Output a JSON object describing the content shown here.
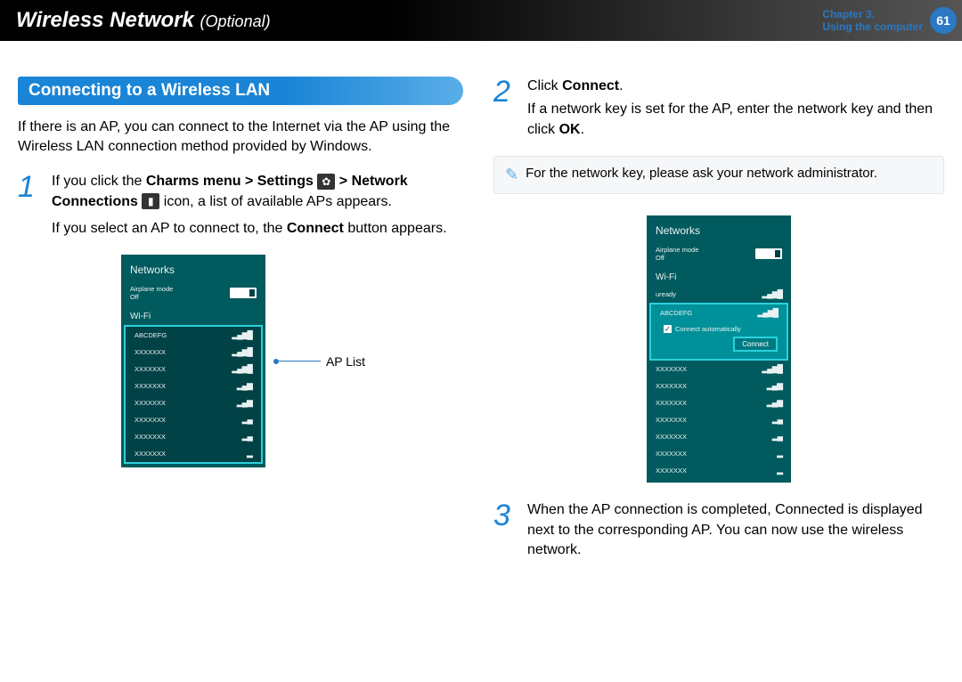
{
  "header": {
    "title": "Wireless Network",
    "subtitle": "(Optional)",
    "chapter_line1": "Chapter 3.",
    "chapter_line2": "Using the computer",
    "page": "61"
  },
  "section_heading": "Connecting to a Wireless LAN",
  "intro": "If there is an AP, you can connect to the Internet via the AP using the Wireless LAN connection method provided by Windows.",
  "steps": {
    "one": {
      "num": "1",
      "a": "If you click the ",
      "b": "Charms menu > Settings",
      "c": " > Network Connections",
      "d": " icon, a list of available APs appears.",
      "e": "If you select an AP to connect to, the ",
      "f": "Connect",
      "g": " button appears."
    },
    "two": {
      "num": "2",
      "a": "Click ",
      "b": "Connect",
      "c": ".",
      "d": "If a network key is set for the AP, enter the network key and then click ",
      "e": "OK",
      "f": "."
    },
    "three": {
      "num": "3",
      "text": "When the AP connection is completed, Connected is displayed next to the corresponding AP. You can now use the wireless network."
    }
  },
  "note": "For the network key, please ask your network administrator.",
  "callout": "AP List",
  "panel": {
    "title": "Networks",
    "airplane": "Airplane mode",
    "off": "Off",
    "wifi": "Wi-Fi",
    "ready": "uready",
    "abc": "ABCDEFG",
    "xxx": "XXXXXXX",
    "auto": "Connect automatically",
    "connect": "Connect"
  }
}
